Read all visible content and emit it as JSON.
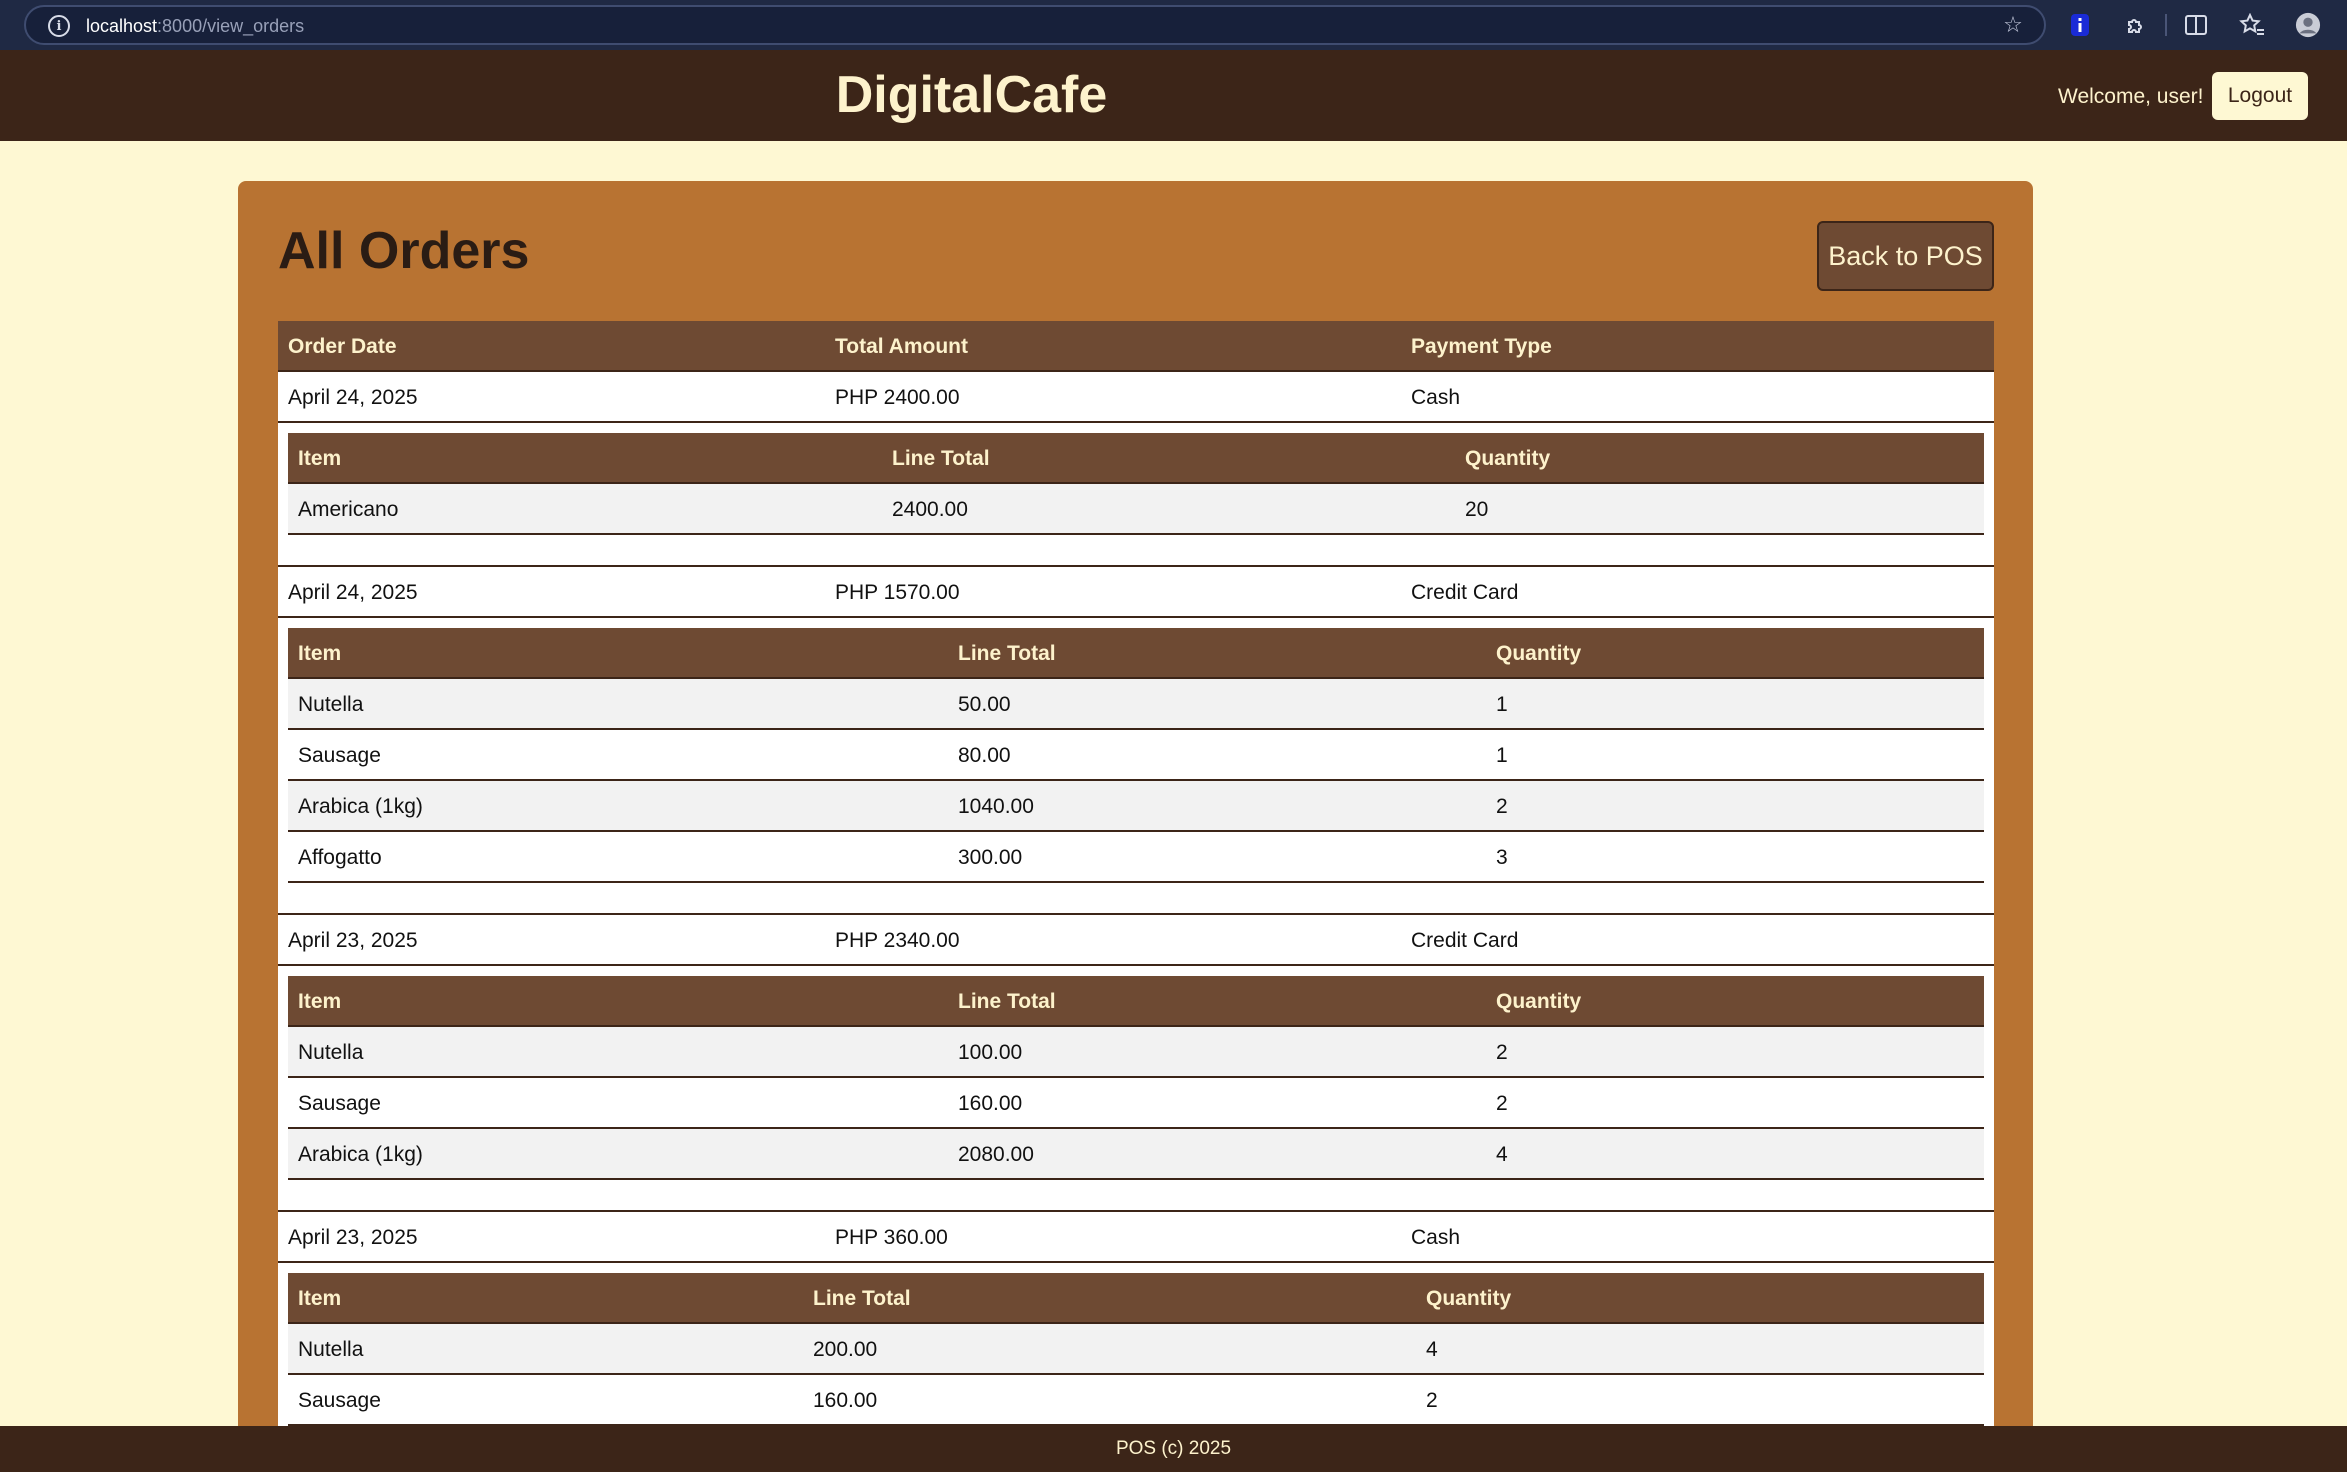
{
  "browser": {
    "url_host": "localhost",
    "url_path": ":8000/view_orders"
  },
  "header": {
    "brand": "DigitalCafe",
    "welcome": "Welcome, user!",
    "logout_label": "Logout"
  },
  "main": {
    "title": "All Orders",
    "back_label": "Back to POS",
    "columns": {
      "order_date": "Order Date",
      "total_amount": "Total Amount",
      "payment_type": "Payment Type"
    },
    "item_columns": {
      "item": "Item",
      "line_total": "Line Total",
      "quantity": "Quantity"
    },
    "orders": [
      {
        "date": "April 24, 2025",
        "total": "PHP 2400.00",
        "payment": "Cash",
        "items": [
          {
            "name": "Americano",
            "line_total": "2400.00",
            "quantity": "20"
          }
        ]
      },
      {
        "date": "April 24, 2025",
        "total": "PHP 1570.00",
        "payment": "Credit Card",
        "items": [
          {
            "name": "Nutella",
            "line_total": "50.00",
            "quantity": "1"
          },
          {
            "name": "Sausage",
            "line_total": "80.00",
            "quantity": "1"
          },
          {
            "name": "Arabica (1kg)",
            "line_total": "1040.00",
            "quantity": "2"
          },
          {
            "name": "Affogatto",
            "line_total": "300.00",
            "quantity": "3"
          }
        ]
      },
      {
        "date": "April 23, 2025",
        "total": "PHP 2340.00",
        "payment": "Credit Card",
        "items": [
          {
            "name": "Nutella",
            "line_total": "100.00",
            "quantity": "2"
          },
          {
            "name": "Sausage",
            "line_total": "160.00",
            "quantity": "2"
          },
          {
            "name": "Arabica (1kg)",
            "line_total": "2080.00",
            "quantity": "4"
          }
        ]
      },
      {
        "date": "April 23, 2025",
        "total": "PHP 360.00",
        "payment": "Cash",
        "items": [
          {
            "name": "Nutella",
            "line_total": "200.00",
            "quantity": "4"
          },
          {
            "name": "Sausage",
            "line_total": "160.00",
            "quantity": "2"
          }
        ]
      }
    ]
  },
  "footer": {
    "text": "POS (c) 2025"
  },
  "colors": {
    "page_bg": "#fef8d3",
    "header_bg": "#3c2518",
    "card_bg": "#b87332",
    "table_head_bg": "#6e4a33",
    "accent_text": "#fdf2cc"
  }
}
